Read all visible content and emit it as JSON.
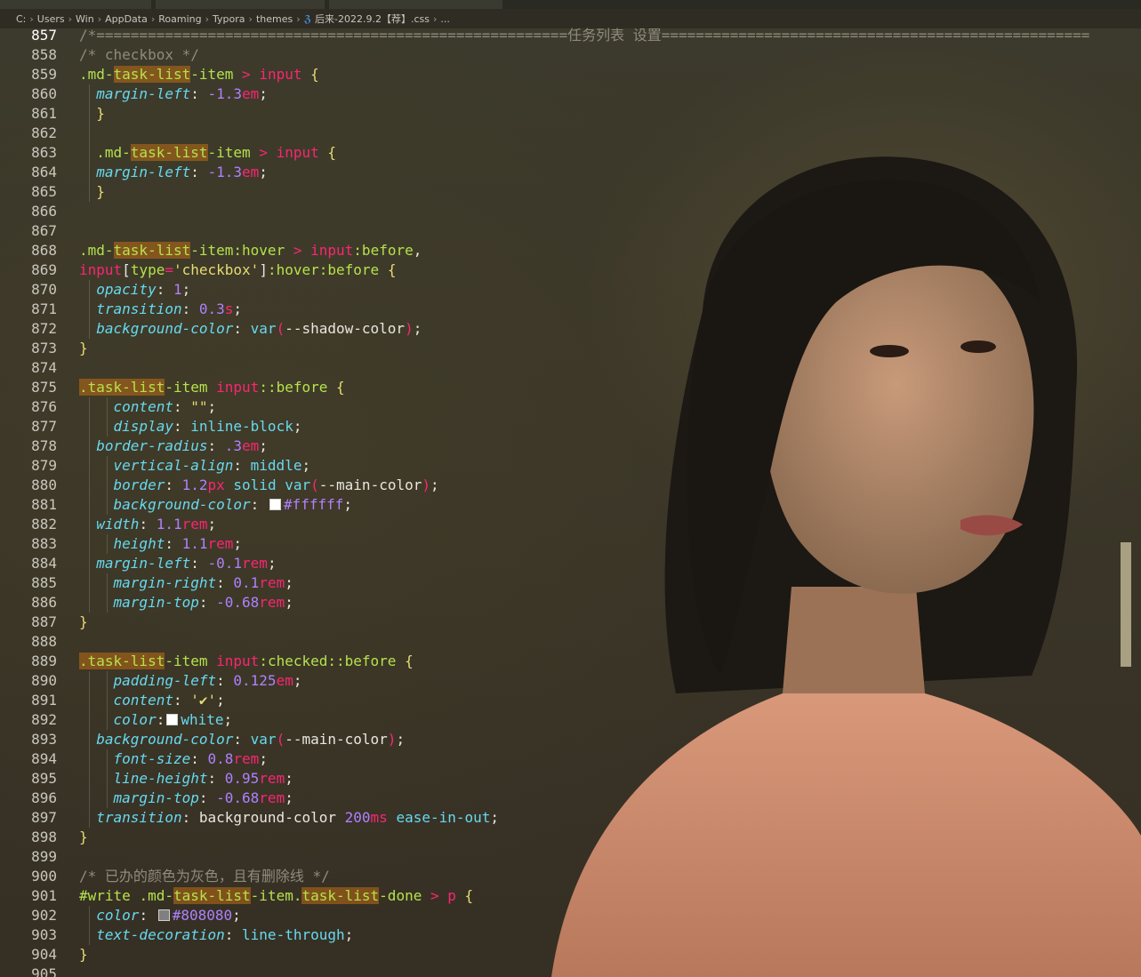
{
  "breadcrumb": {
    "parts": [
      "C:",
      "Users",
      "Win",
      "AppData",
      "Roaming",
      "Typora",
      "themes"
    ],
    "file_icon": "css-file-icon",
    "file_name": "后来-2022.9.2【荐】.css",
    "ellipsis": "..."
  },
  "editor": {
    "current_line": 857,
    "lines": [
      {
        "n": "857",
        "t": [
          [
            "c-comment",
            "/*=======================================================任务列表 设置=================================================="
          ]
        ]
      },
      {
        "n": "858",
        "t": [
          [
            "c-comment",
            "/* checkbox */"
          ]
        ]
      },
      {
        "n": "859",
        "t": [
          [
            "c-sel",
            ".md-"
          ],
          [
            "c-hl",
            "task-list"
          ],
          [
            "c-sel",
            "-item"
          ],
          [
            "c-pn",
            " "
          ],
          [
            "c-op",
            ">"
          ],
          [
            "c-pn",
            " "
          ],
          [
            "c-tag",
            "input"
          ],
          [
            "c-pn",
            " "
          ],
          [
            "c-brace",
            "{"
          ]
        ]
      },
      {
        "n": "860",
        "t": [
          [
            "c-pn",
            "  "
          ],
          [
            "c-prop",
            "margin-left"
          ],
          [
            "c-pn",
            ": "
          ],
          [
            "c-num",
            "-1.3"
          ],
          [
            "c-unit",
            "em"
          ],
          [
            "c-pn",
            ";"
          ]
        ]
      },
      {
        "n": "861",
        "t": [
          [
            "c-pn",
            "  "
          ],
          [
            "c-brace",
            "}"
          ]
        ]
      },
      {
        "n": "862",
        "t": []
      },
      {
        "n": "863",
        "t": [
          [
            "c-pn",
            "  "
          ],
          [
            "c-sel",
            ".md-"
          ],
          [
            "c-hl",
            "task-list"
          ],
          [
            "c-sel",
            "-item"
          ],
          [
            "c-pn",
            " "
          ],
          [
            "c-op",
            ">"
          ],
          [
            "c-pn",
            " "
          ],
          [
            "c-tag",
            "input"
          ],
          [
            "c-pn",
            " "
          ],
          [
            "c-brace",
            "{"
          ]
        ]
      },
      {
        "n": "864",
        "t": [
          [
            "c-pn",
            "  "
          ],
          [
            "c-prop",
            "margin-left"
          ],
          [
            "c-pn",
            ": "
          ],
          [
            "c-num",
            "-1.3"
          ],
          [
            "c-unit",
            "em"
          ],
          [
            "c-pn",
            ";"
          ]
        ]
      },
      {
        "n": "865",
        "t": [
          [
            "c-pn",
            "  "
          ],
          [
            "c-brace",
            "}"
          ]
        ]
      },
      {
        "n": "866",
        "t": []
      },
      {
        "n": "867",
        "t": []
      },
      {
        "n": "868",
        "t": [
          [
            "c-sel",
            ".md-"
          ],
          [
            "c-hl",
            "task-list"
          ],
          [
            "c-sel",
            "-item:hover"
          ],
          [
            "c-pn",
            " "
          ],
          [
            "c-op",
            ">"
          ],
          [
            "c-pn",
            " "
          ],
          [
            "c-tag",
            "input"
          ],
          [
            "c-sel",
            ":before"
          ],
          [
            "c-pn",
            ","
          ]
        ]
      },
      {
        "n": "869",
        "t": [
          [
            "c-tag",
            "input"
          ],
          [
            "c-pn",
            "["
          ],
          [
            "c-sel",
            "type"
          ],
          [
            "c-op",
            "="
          ],
          [
            "c-str",
            "'checkbox'"
          ],
          [
            "c-pn",
            "]"
          ],
          [
            "c-sel",
            ":hover:before"
          ],
          [
            "c-pn",
            " "
          ],
          [
            "c-brace",
            "{"
          ]
        ]
      },
      {
        "n": "870",
        "t": [
          [
            "c-pn",
            "  "
          ],
          [
            "c-prop",
            "opacity"
          ],
          [
            "c-pn",
            ": "
          ],
          [
            "c-num",
            "1"
          ],
          [
            "c-pn",
            ";"
          ]
        ]
      },
      {
        "n": "871",
        "t": [
          [
            "c-pn",
            "  "
          ],
          [
            "c-prop",
            "transition"
          ],
          [
            "c-pn",
            ": "
          ],
          [
            "c-num",
            "0.3"
          ],
          [
            "c-unit",
            "s"
          ],
          [
            "c-pn",
            ";"
          ]
        ]
      },
      {
        "n": "872",
        "t": [
          [
            "c-pn",
            "  "
          ],
          [
            "c-prop",
            "background-color"
          ],
          [
            "c-pn",
            ": "
          ],
          [
            "c-val",
            "var"
          ],
          [
            "c-op",
            "("
          ],
          [
            "c-var",
            "--shadow-color"
          ],
          [
            "c-op",
            ")"
          ],
          [
            "c-pn",
            ";"
          ]
        ]
      },
      {
        "n": "873",
        "t": [
          [
            "c-brace",
            "}"
          ]
        ]
      },
      {
        "n": "874",
        "t": []
      },
      {
        "n": "875",
        "t": [
          [
            "c-hl",
            ".task-list"
          ],
          [
            "c-sel",
            "-item"
          ],
          [
            "c-pn",
            " "
          ],
          [
            "c-tag",
            "input"
          ],
          [
            "c-sel",
            "::before"
          ],
          [
            "c-pn",
            " "
          ],
          [
            "c-brace",
            "{"
          ]
        ]
      },
      {
        "n": "876",
        "t": [
          [
            "c-pn",
            "    "
          ],
          [
            "c-prop",
            "content"
          ],
          [
            "c-pn",
            ": "
          ],
          [
            "c-str",
            "\"\""
          ],
          [
            "c-pn",
            ";"
          ]
        ]
      },
      {
        "n": "877",
        "t": [
          [
            "c-pn",
            "    "
          ],
          [
            "c-prop",
            "display"
          ],
          [
            "c-pn",
            ": "
          ],
          [
            "c-val",
            "inline-block"
          ],
          [
            "c-pn",
            ";"
          ]
        ]
      },
      {
        "n": "878",
        "t": [
          [
            "c-pn",
            "  "
          ],
          [
            "c-prop",
            "border-radius"
          ],
          [
            "c-pn",
            ": "
          ],
          [
            "c-num",
            ".3"
          ],
          [
            "c-unit",
            "em"
          ],
          [
            "c-pn",
            ";"
          ]
        ]
      },
      {
        "n": "879",
        "t": [
          [
            "c-pn",
            "    "
          ],
          [
            "c-prop",
            "vertical-align"
          ],
          [
            "c-pn",
            ": "
          ],
          [
            "c-val",
            "middle"
          ],
          [
            "c-pn",
            ";"
          ]
        ]
      },
      {
        "n": "880",
        "t": [
          [
            "c-pn",
            "    "
          ],
          [
            "c-prop",
            "border"
          ],
          [
            "c-pn",
            ": "
          ],
          [
            "c-num",
            "1.2"
          ],
          [
            "c-unit",
            "px"
          ],
          [
            "c-pn",
            " "
          ],
          [
            "c-val",
            "solid"
          ],
          [
            "c-pn",
            " "
          ],
          [
            "c-val",
            "var"
          ],
          [
            "c-op",
            "("
          ],
          [
            "c-var",
            "--main-color"
          ],
          [
            "c-op",
            ")"
          ],
          [
            "c-pn",
            ";"
          ]
        ]
      },
      {
        "n": "881",
        "t": [
          [
            "c-pn",
            "    "
          ],
          [
            "c-prop",
            "background-color"
          ],
          [
            "c-pn",
            ": "
          ],
          [
            "swatch",
            "#ffffff"
          ],
          [
            "c-num",
            "#ffffff"
          ],
          [
            "c-pn",
            ";"
          ]
        ]
      },
      {
        "n": "882",
        "t": [
          [
            "c-pn",
            "  "
          ],
          [
            "c-prop",
            "width"
          ],
          [
            "c-pn",
            ": "
          ],
          [
            "c-num",
            "1.1"
          ],
          [
            "c-unit",
            "rem"
          ],
          [
            "c-pn",
            ";"
          ]
        ]
      },
      {
        "n": "883",
        "t": [
          [
            "c-pn",
            "    "
          ],
          [
            "c-prop",
            "height"
          ],
          [
            "c-pn",
            ": "
          ],
          [
            "c-num",
            "1.1"
          ],
          [
            "c-unit",
            "rem"
          ],
          [
            "c-pn",
            ";"
          ]
        ]
      },
      {
        "n": "884",
        "t": [
          [
            "c-pn",
            "  "
          ],
          [
            "c-prop",
            "margin-left"
          ],
          [
            "c-pn",
            ": "
          ],
          [
            "c-num",
            "-0.1"
          ],
          [
            "c-unit",
            "rem"
          ],
          [
            "c-pn",
            ";"
          ]
        ]
      },
      {
        "n": "885",
        "t": [
          [
            "c-pn",
            "    "
          ],
          [
            "c-prop",
            "margin-right"
          ],
          [
            "c-pn",
            ": "
          ],
          [
            "c-num",
            "0.1"
          ],
          [
            "c-unit",
            "rem"
          ],
          [
            "c-pn",
            ";"
          ]
        ]
      },
      {
        "n": "886",
        "t": [
          [
            "c-pn",
            "    "
          ],
          [
            "c-prop",
            "margin-top"
          ],
          [
            "c-pn",
            ": "
          ],
          [
            "c-num",
            "-0.68"
          ],
          [
            "c-unit",
            "rem"
          ],
          [
            "c-pn",
            ";"
          ]
        ]
      },
      {
        "n": "887",
        "t": [
          [
            "c-brace",
            "}"
          ]
        ]
      },
      {
        "n": "888",
        "t": []
      },
      {
        "n": "889",
        "t": [
          [
            "c-hl",
            ".task-list"
          ],
          [
            "c-sel",
            "-item"
          ],
          [
            "c-pn",
            " "
          ],
          [
            "c-tag",
            "input"
          ],
          [
            "c-sel",
            ":checked::before"
          ],
          [
            "c-pn",
            " "
          ],
          [
            "c-brace",
            "{"
          ]
        ]
      },
      {
        "n": "890",
        "t": [
          [
            "c-pn",
            "    "
          ],
          [
            "c-prop",
            "padding-left"
          ],
          [
            "c-pn",
            ": "
          ],
          [
            "c-num",
            "0.125"
          ],
          [
            "c-unit",
            "em"
          ],
          [
            "c-pn",
            ";"
          ]
        ]
      },
      {
        "n": "891",
        "t": [
          [
            "c-pn",
            "    "
          ],
          [
            "c-prop",
            "content"
          ],
          [
            "c-pn",
            ": "
          ],
          [
            "c-str",
            "'✔'"
          ],
          [
            "c-pn",
            ";"
          ]
        ]
      },
      {
        "n": "892",
        "t": [
          [
            "c-pn",
            "    "
          ],
          [
            "c-prop",
            "color"
          ],
          [
            "c-pn",
            ":"
          ],
          [
            "swatch",
            "#ffffff"
          ],
          [
            "c-val",
            "white"
          ],
          [
            "c-pn",
            ";"
          ]
        ]
      },
      {
        "n": "893",
        "t": [
          [
            "c-pn",
            "  "
          ],
          [
            "c-prop",
            "background-color"
          ],
          [
            "c-pn",
            ": "
          ],
          [
            "c-val",
            "var"
          ],
          [
            "c-op",
            "("
          ],
          [
            "c-var",
            "--main-color"
          ],
          [
            "c-op",
            ")"
          ],
          [
            "c-pn",
            ";"
          ]
        ]
      },
      {
        "n": "894",
        "t": [
          [
            "c-pn",
            "    "
          ],
          [
            "c-prop",
            "font-size"
          ],
          [
            "c-pn",
            ": "
          ],
          [
            "c-num",
            "0.8"
          ],
          [
            "c-unit",
            "rem"
          ],
          [
            "c-pn",
            ";"
          ]
        ]
      },
      {
        "n": "895",
        "t": [
          [
            "c-pn",
            "    "
          ],
          [
            "c-prop",
            "line-height"
          ],
          [
            "c-pn",
            ": "
          ],
          [
            "c-num",
            "0.95"
          ],
          [
            "c-unit",
            "rem"
          ],
          [
            "c-pn",
            ";"
          ]
        ]
      },
      {
        "n": "896",
        "t": [
          [
            "c-pn",
            "    "
          ],
          [
            "c-prop",
            "margin-top"
          ],
          [
            "c-pn",
            ": "
          ],
          [
            "c-num",
            "-0.68"
          ],
          [
            "c-unit",
            "rem"
          ],
          [
            "c-pn",
            ";"
          ]
        ]
      },
      {
        "n": "897",
        "t": [
          [
            "c-pn",
            "  "
          ],
          [
            "c-prop",
            "transition"
          ],
          [
            "c-pn",
            ": "
          ],
          [
            "c-var",
            "background-color"
          ],
          [
            "c-pn",
            " "
          ],
          [
            "c-num",
            "200"
          ],
          [
            "c-unit",
            "ms"
          ],
          [
            "c-pn",
            " "
          ],
          [
            "c-val",
            "ease-in-out"
          ],
          [
            "c-pn",
            ";"
          ]
        ]
      },
      {
        "n": "898",
        "t": [
          [
            "c-brace",
            "}"
          ]
        ]
      },
      {
        "n": "899",
        "t": []
      },
      {
        "n": "900",
        "t": [
          [
            "c-comment",
            "/* 已办的颜色为灰色，且有删除线 */"
          ]
        ]
      },
      {
        "n": "901",
        "t": [
          [
            "c-id",
            "#write"
          ],
          [
            "c-pn",
            " "
          ],
          [
            "c-sel",
            ".md-"
          ],
          [
            "c-hl",
            "task-list"
          ],
          [
            "c-sel",
            "-item."
          ],
          [
            "c-hl",
            "task-list"
          ],
          [
            "c-sel",
            "-done"
          ],
          [
            "c-pn",
            " "
          ],
          [
            "c-op",
            ">"
          ],
          [
            "c-pn",
            " "
          ],
          [
            "c-tag",
            "p"
          ],
          [
            "c-pn",
            " "
          ],
          [
            "c-brace",
            "{"
          ]
        ]
      },
      {
        "n": "902",
        "t": [
          [
            "c-pn",
            "  "
          ],
          [
            "c-prop",
            "color"
          ],
          [
            "c-pn",
            ": "
          ],
          [
            "swatch",
            "#808080"
          ],
          [
            "c-num",
            "#808080"
          ],
          [
            "c-pn",
            ";"
          ]
        ]
      },
      {
        "n": "903",
        "t": [
          [
            "c-pn",
            "  "
          ],
          [
            "c-prop",
            "text-decoration"
          ],
          [
            "c-pn",
            ": "
          ],
          [
            "c-val",
            "line-through"
          ],
          [
            "c-pn",
            ";"
          ]
        ]
      },
      {
        "n": "904",
        "t": [
          [
            "c-brace",
            "}"
          ]
        ]
      },
      {
        "n": "905",
        "t": []
      }
    ]
  }
}
